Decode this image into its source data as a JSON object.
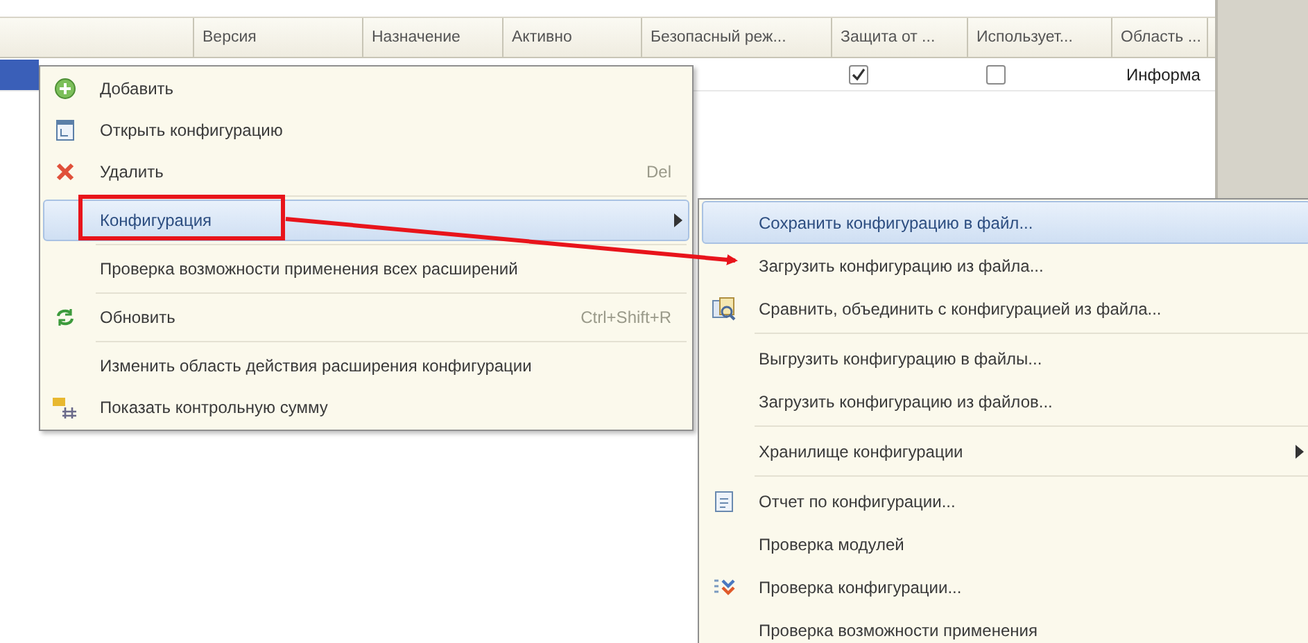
{
  "table": {
    "columns": [
      "Версия",
      "Назначение",
      "Активно",
      "Безопасный реж...",
      "Защита от ...",
      "Использует...",
      "Область ..."
    ],
    "rows": [
      {
        "selected": true,
        "protection_checked": true,
        "uses_checked": false,
        "area": "Информа"
      }
    ]
  },
  "context_menu": {
    "items": [
      {
        "kind": "item",
        "label": "Добавить",
        "selected": false,
        "submenu": false
      },
      {
        "kind": "item",
        "label": "Открыть конфигурацию",
        "selected": false,
        "submenu": false
      },
      {
        "kind": "item",
        "label": "Удалить",
        "shortcut": "Del",
        "selected": false,
        "submenu": false
      },
      {
        "kind": "separator"
      },
      {
        "kind": "item",
        "label": "Конфигурация",
        "selected": true,
        "submenu": true
      },
      {
        "kind": "separator"
      },
      {
        "kind": "item",
        "label": "Проверка возможности применения всех расширений",
        "selected": false,
        "submenu": false
      },
      {
        "kind": "separator"
      },
      {
        "kind": "item",
        "label": "Обновить",
        "shortcut": "Ctrl+Shift+R",
        "selected": false,
        "submenu": false
      },
      {
        "kind": "separator"
      },
      {
        "kind": "item",
        "label": "Изменить область действия расширения конфигурации",
        "selected": false,
        "submenu": false
      },
      {
        "kind": "item",
        "label": "Показать контрольную сумму",
        "selected": false,
        "submenu": false
      }
    ]
  },
  "submenu": {
    "items": [
      {
        "kind": "item",
        "label": "Сохранить конфигурацию в файл...",
        "selected": true,
        "submenu": false
      },
      {
        "kind": "item",
        "label": "Загрузить конфигурацию из файла...",
        "selected": false,
        "submenu": false
      },
      {
        "kind": "item",
        "label": "Сравнить, объединить с конфигурацией из файла...",
        "selected": false,
        "submenu": false
      },
      {
        "kind": "separator"
      },
      {
        "kind": "item",
        "label": "Выгрузить конфигурацию в файлы...",
        "selected": false,
        "submenu": false
      },
      {
        "kind": "item",
        "label": "Загрузить конфигурацию из файлов...",
        "selected": false,
        "submenu": false
      },
      {
        "kind": "separator"
      },
      {
        "kind": "item",
        "label": "Хранилище конфигурации",
        "selected": false,
        "submenu": true
      },
      {
        "kind": "separator"
      },
      {
        "kind": "item",
        "label": "Отчет по конфигурации...",
        "selected": false,
        "submenu": false
      },
      {
        "kind": "item",
        "label": "Проверка модулей",
        "selected": false,
        "submenu": false
      },
      {
        "kind": "item",
        "label": "Проверка конфигурации...",
        "selected": false,
        "submenu": false
      },
      {
        "kind": "item",
        "label": "Проверка возможности применения",
        "selected": false,
        "submenu": false
      }
    ]
  },
  "annotation": {
    "highlight": true,
    "arrow": true
  }
}
